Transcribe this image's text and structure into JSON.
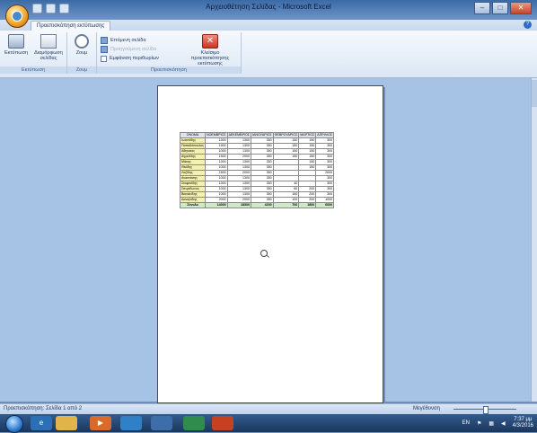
{
  "window": {
    "title": "Αρχειοθέτηση Σελίδας - Microsoft Excel"
  },
  "ribbon": {
    "tab_label": "Προεπισκόπηση εκτύπωσης",
    "print_button": "Εκτύπωση",
    "page_setup_button": "Διαμόρφωση σελίδας",
    "zoom_button": "Ζουμ",
    "next_page": "Επόμενη σελίδα",
    "previous_page": "Προηγούμενη σελίδα",
    "show_margins": "Εμφάνιση περιθωρίων",
    "close_preview_button": "Κλείσιμο προεπισκόπησης εκτύπωσης",
    "group_print": "Εκτύπωση",
    "group_zoom": "Ζουμ",
    "group_preview": "Προεπισκόπηση"
  },
  "sheet": {
    "headers": [
      "ΟΝΟΜΑ",
      "ΝΟΕΜΒΡΙΟΣ",
      "ΔΕΚΕΜΒΡΙΟΣ",
      "ΙΑΝΟΥΑΡΙΟΣ",
      "ΦΕΒΡΟΥΑΡΙΟΣ",
      "ΜΑΡΤΙΟΣ",
      "ΑΠΡΙΛΙΟΣ"
    ],
    "rows": [
      [
        "Ιωαννίδης",
        "1000",
        "1300",
        "350",
        "150",
        "150",
        "300"
      ],
      [
        "Παπαδόπουλος",
        "1500",
        "1300",
        "350",
        "150",
        "150",
        "300"
      ],
      [
        "Αθηναίος",
        "1000",
        "1300",
        "350",
        "150",
        "150",
        "300"
      ],
      [
        "Αγγελίδης",
        "1500",
        "2000",
        "350",
        "150",
        "150",
        "300"
      ],
      [
        "Μάκης",
        "1000",
        "1300",
        "350",
        "",
        "150",
        "300"
      ],
      [
        "Θεόδης",
        "1000",
        "1300",
        "350",
        "",
        "150",
        "300"
      ],
      [
        "Λαζίδης",
        "1500",
        "2000",
        "350",
        "",
        "",
        "2000"
      ],
      [
        "Αναστάσης",
        "1000",
        "1300",
        "350",
        "",
        "",
        "300"
      ],
      [
        "Στεφανίδης",
        "1000",
        "1300",
        "350",
        "40",
        "",
        "300"
      ],
      [
        "Σπυρίδωνος",
        "1000",
        "1300",
        "350",
        "60",
        "200",
        "300"
      ],
      [
        "Βασιλείδης",
        "1000",
        "1300",
        "350",
        "150",
        "200",
        "300"
      ],
      [
        "Δανιηλίδης",
        "2000",
        "2000",
        "350",
        "100",
        "200",
        "1000"
      ]
    ],
    "totals": [
      "Σύνολο",
      "14000",
      "18300",
      "4200",
      "700",
      "1800",
      "6000"
    ]
  },
  "statusbar": {
    "page_info": "Προεπισκόπηση: Σελίδα 1 από 2",
    "zoom_label": "Μεγέθυνση"
  },
  "taskbar": {
    "language": "EN",
    "time": "7:37 μμ",
    "date": "4/3/2016"
  }
}
